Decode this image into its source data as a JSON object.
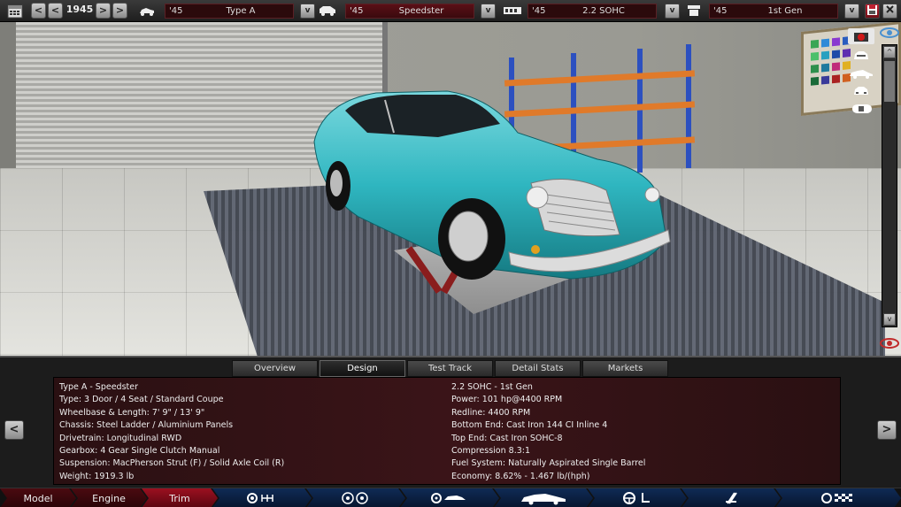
{
  "topbar": {
    "year": "1945",
    "prev_label": "<",
    "prev2_label": "<",
    "next_label": ">",
    "next2_label": ">",
    "selectors": [
      {
        "icon": "car-body-icon",
        "year": "'45",
        "value": "Type A"
      },
      {
        "icon": "van-icon",
        "year": "'45",
        "value": "Speedster"
      },
      {
        "icon": "engine-block-icon",
        "year": "'45",
        "value": "2.2 SOHC"
      },
      {
        "icon": "engine-family-icon",
        "year": "'45",
        "value": "1st Gen"
      }
    ],
    "dropdown_label": "v",
    "save_icon": "save-icon",
    "close_icon": "close-icon"
  },
  "scene": {
    "car_color": "#2fb6c0",
    "view_buttons": [
      "camera-view-icon",
      "front-view-icon",
      "side-view-icon",
      "rear-view-icon",
      "top-view-icon"
    ],
    "scroll_up": "^",
    "scroll_down": "v"
  },
  "tabs": [
    "Overview",
    "Design",
    "Test Track",
    "Detail Stats",
    "Markets"
  ],
  "active_tab": "Design",
  "info": {
    "left": [
      "Type A - Speedster",
      "Type: 3 Door / 4 Seat / Standard Coupe",
      "Wheelbase & Length: 7' 9\" / 13' 9\"",
      "Chassis: Steel Ladder / Aluminium Panels",
      "Drivetrain: Longitudinal RWD",
      "Gearbox: 4 Gear Single Clutch Manual",
      "Suspension: MacPherson Strut (F) / Solid Axle Coil (R)",
      "Weight: 1919.3 lb"
    ],
    "right": [
      "2.2 SOHC - 1st Gen",
      "Power: 101 hp@4400 RPM",
      "Redline: 4400 RPM",
      "Bottom End: Cast Iron 144 CI Inline 4",
      "Top End: Cast Iron SOHC-8",
      "Compression 8.3:1",
      "Fuel System: Naturally Aspirated Single Barrel",
      "Economy: 8.62% - 1.467 lb/(hph)"
    ],
    "prev_label": "<",
    "next_label": ">"
  },
  "bottomnav": {
    "words": [
      "Model",
      "Engine",
      "Trim"
    ],
    "active": "Trim",
    "icons": [
      "gearbox-icon",
      "wheels-icon",
      "suspension-icon",
      "body-design-icon",
      "interior-icon",
      "safety-icon",
      "test-track-icon"
    ]
  }
}
